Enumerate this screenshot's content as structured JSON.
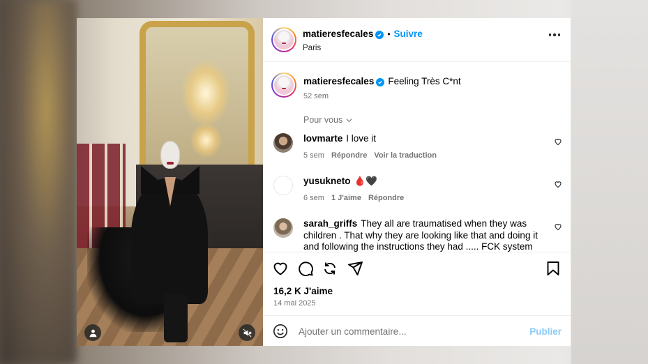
{
  "post": {
    "username": "matieresfecales",
    "follow_label": "Suivre",
    "separator": "•",
    "location": "Paris",
    "caption_text": "Feeling Très C*nt",
    "caption_time": "52 sem"
  },
  "comments": {
    "filter_label": "Pour vous",
    "items": [
      {
        "username": "lovmarte",
        "text": "I love it",
        "time": "5 sem",
        "actions": [
          "Répondre",
          "Voir la traduction"
        ],
        "likes": ""
      },
      {
        "username": "yusukneto",
        "text": "🩸🖤",
        "time": "6 sem",
        "likes": "1 J'aime",
        "actions": [
          "Répondre"
        ]
      },
      {
        "username": "sarah_griffs",
        "text": "They all are traumatised when they was children . That why they are looking like that and doing it and following the instructions they had ..... FCK system",
        "time": "",
        "actions": [],
        "likes": ""
      }
    ]
  },
  "engagement": {
    "likes": "16,2 K J'aime",
    "date": "14 mai 2025"
  },
  "composer": {
    "placeholder": "Ajouter un commentaire...",
    "publish_label": "Publier"
  },
  "icons": {
    "like": "heart-icon",
    "comment": "comment-bubble-icon",
    "share": "repost-icon",
    "send": "paper-plane-icon",
    "save": "bookmark-icon",
    "emoji": "emoji-icon",
    "more": "more-options-icon",
    "tag": "user-tag-icon",
    "mute": "mute-icon"
  },
  "colors": {
    "accent": "#0095f6",
    "publish_disabled": "#8ccbf8",
    "muted_text": "#737373"
  }
}
